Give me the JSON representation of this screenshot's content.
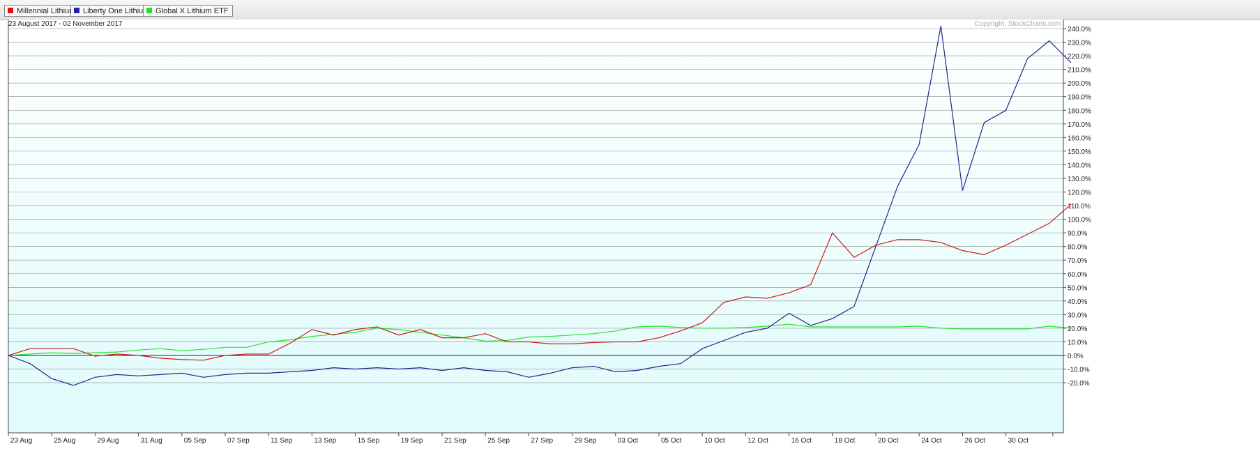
{
  "legend": [
    {
      "label": "Millennial Lithium",
      "color": "#e01010"
    },
    {
      "label": "Liberty One Lithium",
      "color": "#2020b0"
    },
    {
      "label": "Global X Lithium ETF",
      "color": "#20e020"
    }
  ],
  "date_range": "23 August 2017 - 02 November 2017",
  "copyright": "Copyright, StockCharts.com",
  "chart_data": {
    "type": "line",
    "x": [
      "23 Aug",
      "24 Aug",
      "25 Aug",
      "28 Aug",
      "29 Aug",
      "30 Aug",
      "31 Aug",
      "01 Sep",
      "05 Sep",
      "06 Sep",
      "07 Sep",
      "08 Sep",
      "11 Sep",
      "12 Sep",
      "13 Sep",
      "14 Sep",
      "15 Sep",
      "18 Sep",
      "19 Sep",
      "20 Sep",
      "21 Sep",
      "22 Sep",
      "25 Sep",
      "26 Sep",
      "27 Sep",
      "28 Sep",
      "29 Sep",
      "02 Oct",
      "03 Oct",
      "04 Oct",
      "05 Oct",
      "06 Oct",
      "10 Oct",
      "11 Oct",
      "12 Oct",
      "13 Oct",
      "16 Oct",
      "17 Oct",
      "18 Oct",
      "19 Oct",
      "20 Oct",
      "23 Oct",
      "24 Oct",
      "25 Oct",
      "26 Oct",
      "27 Oct",
      "30 Oct",
      "31 Oct",
      "01 Nov",
      "02 Nov"
    ],
    "x_tick_labels": [
      "23 Aug",
      "25 Aug",
      "29 Aug",
      "31 Aug",
      "05 Sep",
      "07 Sep",
      "11 Sep",
      "13 Sep",
      "15 Sep",
      "19 Sep",
      "21 Sep",
      "25 Sep",
      "27 Sep",
      "29 Sep",
      "03 Oct",
      "05 Oct",
      "10 Oct",
      "12 Oct",
      "16 Oct",
      "18 Oct",
      "20 Oct",
      "24 Oct",
      "26 Oct",
      "30 Oct"
    ],
    "y_ticks": [
      -20,
      -10,
      0,
      10,
      20,
      30,
      40,
      50,
      60,
      70,
      80,
      90,
      100,
      110,
      120,
      130,
      140,
      150,
      160,
      170,
      180,
      190,
      200,
      210,
      220,
      230,
      240
    ],
    "y_tick_labels": [
      "-20.0%",
      "-10.0%",
      "0.0%",
      "10.0%",
      "20.0%",
      "30.0%",
      "40.0%",
      "50.0%",
      "60.0%",
      "70.0%",
      "80.0%",
      "90.0%",
      "100.0%",
      "110.0%",
      "120.0%",
      "130.0%",
      "140.0%",
      "150.0%",
      "160.0%",
      "170.0%",
      "180.0%",
      "190.0%",
      "200.0%",
      "210.0%",
      "220.0%",
      "230.0%",
      "240.0%"
    ],
    "ylim": [
      -24,
      245
    ],
    "grid": true,
    "series": [
      {
        "name": "Millennial Lithium",
        "color": "#d01818",
        "values": [
          0,
          5,
          5,
          5,
          -0.5,
          1,
          0,
          -2,
          -3,
          -3.5,
          0,
          1,
          1,
          9,
          19,
          15,
          19,
          21,
          15,
          19,
          13,
          13,
          16,
          10,
          10,
          8.5,
          8.5,
          9.5,
          10,
          10,
          13,
          18,
          24,
          39,
          43,
          42,
          46,
          52,
          90,
          72,
          81,
          85,
          85,
          83,
          77,
          74,
          81,
          89,
          97,
          111
        ]
      },
      {
        "name": "Liberty One Lithium",
        "color": "#24248a",
        "values": [
          0,
          -6,
          -17,
          -22,
          -16,
          -14,
          -15,
          -14,
          -13,
          -16,
          -14,
          -13,
          -13,
          -12,
          -11,
          -9,
          -10,
          -9,
          -10,
          -9,
          -11,
          -9,
          -11,
          -12,
          -16,
          -13,
          -9,
          -8,
          -12,
          -11,
          -8,
          -6,
          5,
          11,
          17,
          20,
          31,
          22,
          27,
          36,
          80,
          124,
          155,
          242,
          121,
          171,
          180,
          218,
          231,
          215
        ]
      },
      {
        "name": "Global X Lithium ETF",
        "color": "#30e030",
        "values": [
          0,
          1,
          2,
          1.5,
          2,
          2.5,
          4,
          5,
          3.5,
          4.5,
          6,
          6,
          10,
          11.5,
          14,
          15.5,
          17,
          20,
          19,
          17,
          15,
          13,
          10.5,
          11,
          13.5,
          14,
          15,
          16,
          18,
          21,
          21.5,
          20.5,
          20,
          20,
          20.5,
          21.5,
          23,
          21,
          21,
          21,
          21,
          21,
          21.5,
          20,
          19.5,
          19.5,
          19.5,
          19.5,
          21.5,
          20
        ]
      }
    ]
  }
}
